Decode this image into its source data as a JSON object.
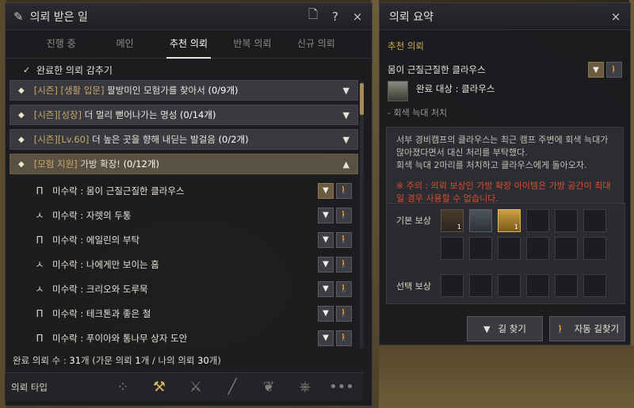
{
  "quest_window": {
    "title": "의뢰 받은 일",
    "icons": {
      "window": "scroll-pen-icon",
      "memo": "memo-icon",
      "help": "?",
      "close": "×"
    },
    "tabs": [
      {
        "label": "진행 중",
        "active": false
      },
      {
        "label": "메인",
        "active": false
      },
      {
        "label": "추천 의뢰",
        "active": true
      },
      {
        "label": "반복 의뢰",
        "active": false
      },
      {
        "label": "신규 의뢰",
        "active": false
      }
    ],
    "hide_completed": {
      "checked": true,
      "label": "완료한 의뢰 감추기"
    },
    "categories": [
      {
        "prefix": "[시즌] [생활 입문] ",
        "name": "팔방미인 모험가를 찾아서",
        "count": "(0/9개)",
        "open": false
      },
      {
        "prefix": "[시즌][성장] ",
        "name": "더 멀리 뻗어나가는 명성",
        "count": "(0/14개)",
        "open": false
      },
      {
        "prefix": "[시즌][Lv.60] ",
        "name": "더 높은 곳을 향해 내딛는 발걸음",
        "count": "(0/2개)",
        "open": false
      },
      {
        "prefix": "[모험 지원] ",
        "name": "가방 확장!",
        "count": "(0/12개)",
        "open": true
      }
    ],
    "quests": [
      {
        "label": "미수락 : 몸이 근질근질한 클라우스",
        "icon": "quest-pillar-icon",
        "selected": true
      },
      {
        "label": "미수락 : 자렛의 두통",
        "icon": "pickaxe-icon",
        "selected": false
      },
      {
        "label": "미수락 : 에일린의 부탁",
        "icon": "quest-pillar-icon",
        "selected": false
      },
      {
        "label": "미수락 : 나에게만 보이는 흠",
        "icon": "pickaxe-icon",
        "selected": false
      },
      {
        "label": "미수락 : 크리오와 도루묵",
        "icon": "pickaxe-icon",
        "selected": false
      },
      {
        "label": "미수락 : 테크톤과 좋은 철",
        "icon": "quest-pillar-icon",
        "selected": false
      },
      {
        "label": "미수락 : 푸이아와 통나무 상자 도안",
        "icon": "quest-pillar-icon",
        "selected": false
      }
    ],
    "footer": {
      "prefix": "완료 의뢰 수 : ",
      "completed": "31",
      "middle": "개 (가문 의뢰 ",
      "family": "1",
      "middle2": "개 / 나의 의뢰 ",
      "mine": "30",
      "suffix": "개)"
    },
    "type_bar": {
      "label": "의뢰 타입",
      "icons": [
        {
          "name": "all-types-icon",
          "glyph": "⁘",
          "active": false
        },
        {
          "name": "adventure-type-icon",
          "glyph": "⚒",
          "active": true
        },
        {
          "name": "combat-type-icon",
          "glyph": "⚔",
          "active": false
        },
        {
          "name": "gathering-type-icon",
          "glyph": "╱",
          "active": false
        },
        {
          "name": "fishing-type-icon",
          "glyph": "❦",
          "active": false
        },
        {
          "name": "trade-type-icon",
          "glyph": "⎈",
          "active": false
        },
        {
          "name": "more-types-icon",
          "glyph": "•••",
          "active": false
        }
      ]
    }
  },
  "summary_window": {
    "title": "의뢰 요약",
    "close": "×",
    "section": "추천 의뢰",
    "quest_name": "몸이 근질근질한 클라우스",
    "target": "완료 대상 : 클라우스",
    "objective": "- 회색 늑대 처치",
    "description": "서부 경비캠프의 클라우스는 최근 캠프 주변에 회색 늑대가 많아졌다면서 대신 처리를 부탁했다.\n회색 늑대 2마리를 처치하고 클라우스에게 돌아오자.",
    "warning": "※ 주의 : 의뢰 보상인 가방 확장 아이템은 가방 공간이 최대일 경우 사용할 수 없습니다.",
    "base_reward_label": "기본 보상",
    "choice_reward_label": "선택 보상",
    "base_rewards": [
      {
        "name": "bag-expansion-item",
        "qty": "1"
      },
      {
        "name": "scroll-item",
        "qty": ""
      },
      {
        "name": "gold-bar-item",
        "qty": "1"
      }
    ],
    "find_path_label": "길 찾기",
    "auto_path_label": "자동 길찾기"
  },
  "colors": {
    "accent_gold": "#d4a94a",
    "warning_red": "#e04a2c",
    "selected_category": "#5b5142"
  }
}
